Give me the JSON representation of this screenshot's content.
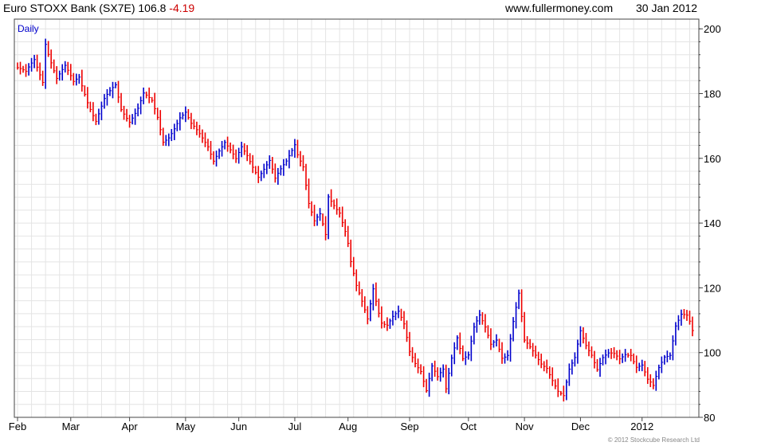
{
  "header": {
    "title": "Euro STOXX Bank (SX7E) 106.8",
    "change": "-4.19",
    "site": "www.fullermoney.com",
    "date": "30 Jan 2012"
  },
  "footer": {
    "copyright": "© 2012 Stockcube Research Ltd"
  },
  "colors": {
    "up": "#0000cc",
    "down": "#ee0000",
    "grid": "#e4e4e4",
    "axis": "#444444",
    "label_blue": "#0000cc"
  },
  "chart_data": {
    "type": "line",
    "interval_label": "Daily",
    "y_ticks": [
      80,
      100,
      120,
      140,
      160,
      180,
      200
    ],
    "ylim": [
      80,
      203
    ],
    "x_ticks": [
      "Feb",
      "Mar",
      "Apr",
      "May",
      "Jun",
      "Jul",
      "Aug",
      "Sep",
      "Oct",
      "Nov",
      "Dec",
      "2012"
    ],
    "x_tick_positions": [
      0,
      19,
      40,
      60,
      79,
      99,
      118,
      140,
      161,
      181,
      201,
      223
    ],
    "n_points": 242,
    "grid": true,
    "series": [
      {
        "anchors_index": [
          0,
          3,
          6,
          9,
          10,
          11,
          14,
          17,
          20,
          22,
          25,
          28,
          30,
          31,
          33,
          35,
          37,
          40,
          43,
          45,
          48,
          50,
          52,
          54,
          56,
          58,
          60,
          62,
          64,
          66,
          68,
          70,
          72,
          74,
          76,
          78,
          80,
          82,
          84,
          86,
          88,
          90,
          92,
          94,
          96,
          98,
          99,
          100,
          102,
          104,
          106,
          108,
          110,
          111,
          113,
          115,
          117,
          118,
          119,
          121,
          123,
          125,
          127,
          129,
          130,
          132,
          134,
          136,
          138,
          140,
          142,
          144,
          146,
          148,
          150,
          152,
          153,
          155,
          157,
          159,
          161,
          163,
          165,
          167,
          169,
          171,
          173,
          175,
          177,
          179,
          181,
          183,
          185,
          187,
          189,
          191,
          193,
          195,
          197,
          199,
          201,
          203,
          205,
          207,
          209,
          211,
          213,
          215,
          217,
          219,
          221,
          223,
          225,
          227,
          229,
          231,
          233,
          235,
          237,
          239,
          241
        ],
        "anchors_value": [
          188,
          186,
          190,
          184,
          196,
          193,
          185,
          188,
          183,
          185,
          178,
          172,
          176,
          178,
          180,
          182,
          175,
          172,
          176,
          180,
          177,
          172,
          165,
          167,
          170,
          173,
          174,
          170,
          168,
          166,
          164,
          160,
          163,
          165,
          162,
          159,
          163,
          161,
          158,
          155,
          157,
          159,
          153,
          156,
          159,
          163,
          165,
          162,
          158,
          146,
          140,
          142,
          136,
          148,
          146,
          144,
          138,
          134,
          128,
          120,
          115,
          110,
          120,
          113,
          110,
          109,
          111,
          112,
          108,
          100,
          97,
          95,
          89,
          96,
          92,
          94,
          88,
          98,
          105,
          99,
          100,
          108,
          111,
          107,
          102,
          104,
          99,
          100,
          110,
          118,
          103,
          101,
          99,
          97,
          96,
          92,
          88,
          86,
          94,
          98,
          107,
          103,
          100,
          95,
          98,
          99,
          99,
          98,
          100,
          100,
          96,
          96,
          91,
          89,
          95,
          99,
          100,
          109,
          112,
          111,
          106.8
        ]
      }
    ]
  }
}
